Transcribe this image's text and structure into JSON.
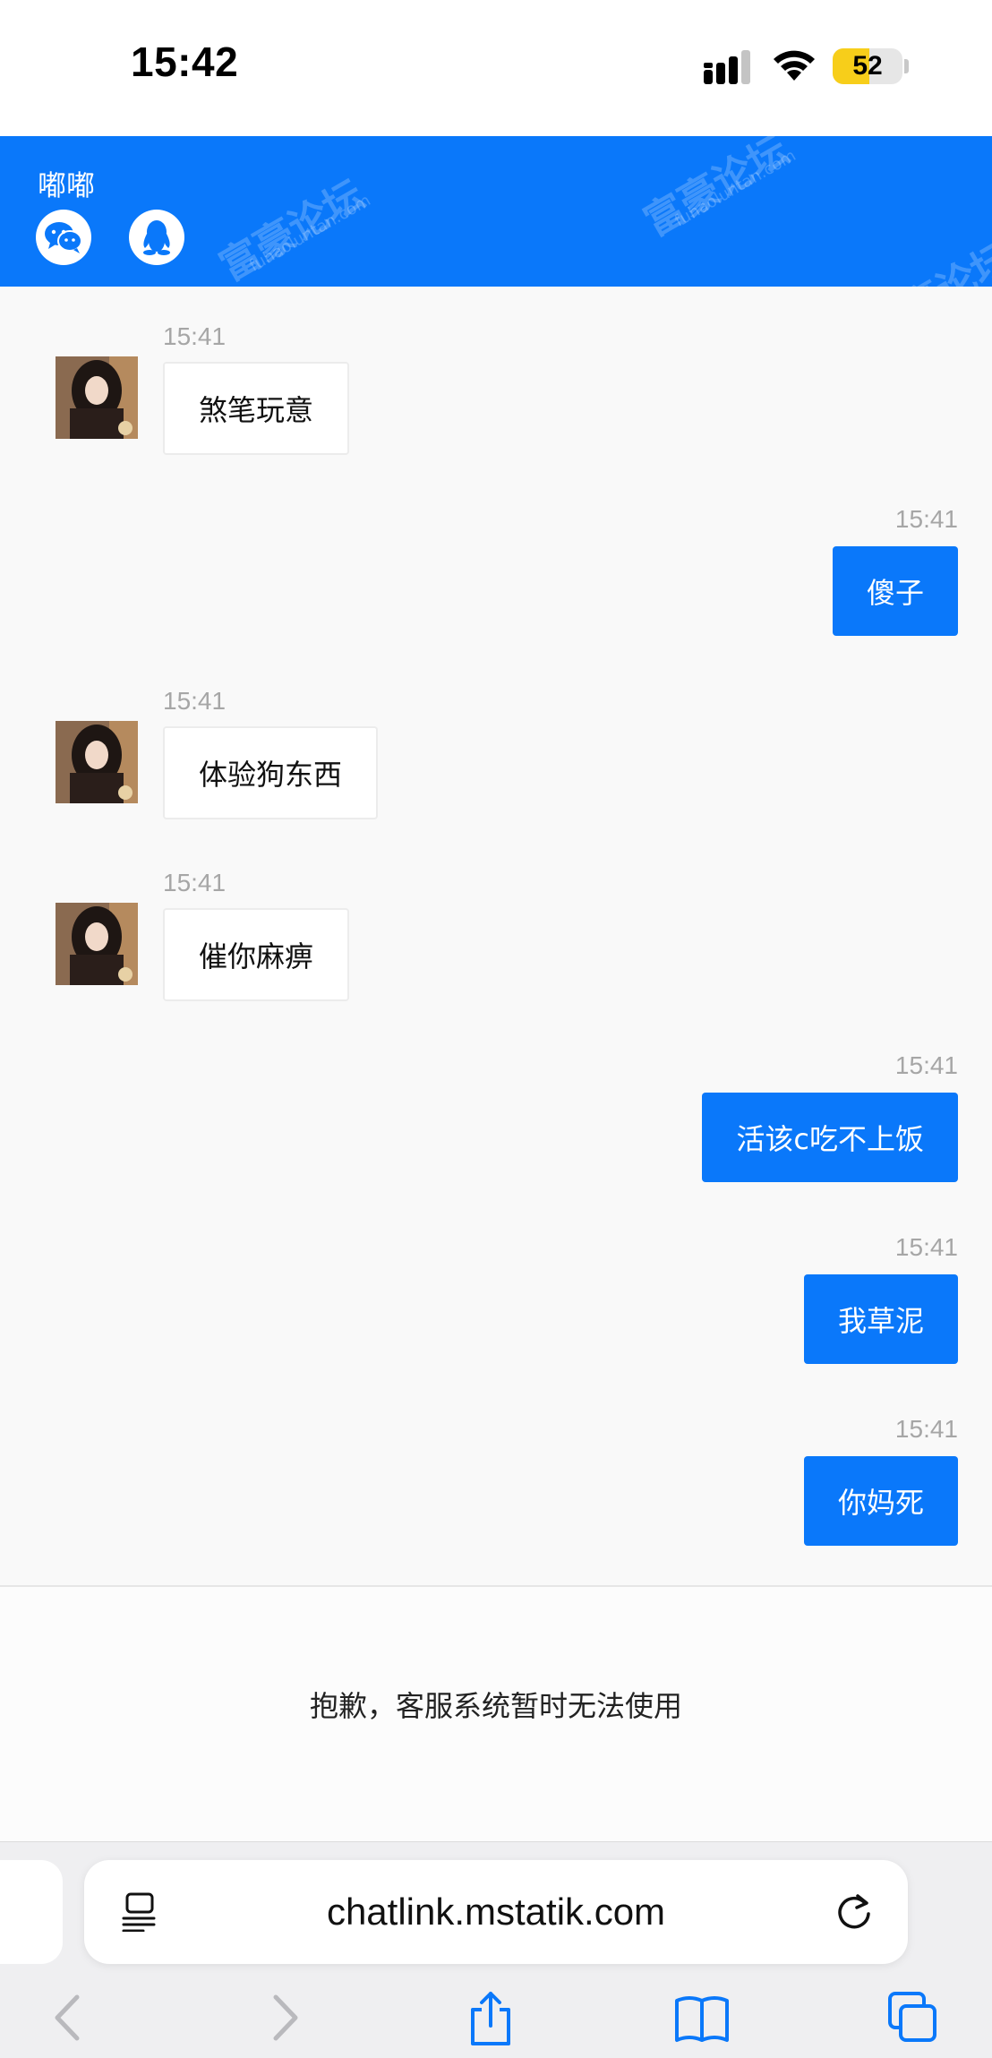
{
  "status_bar": {
    "time": "15:42",
    "battery": "52",
    "battery_level": 0.52
  },
  "header": {
    "title": "嘟嘟",
    "icons": [
      "wechat-icon",
      "qq-icon"
    ],
    "watermark": "富豪论坛",
    "watermark_sub": "fuhaoluntan.com",
    "color": "#0a78fa"
  },
  "messages": [
    {
      "direction": "incoming",
      "time": "15:41",
      "text": "煞笔玩意"
    },
    {
      "direction": "outgoing",
      "time": "15:41",
      "text": "傻子"
    },
    {
      "direction": "incoming",
      "time": "15:41",
      "text": "体验狗东西"
    },
    {
      "direction": "incoming",
      "time": "15:41",
      "text": "催你麻痹"
    },
    {
      "direction": "outgoing",
      "time": "15:41",
      "text": "活该c吃不上饭"
    },
    {
      "direction": "outgoing",
      "time": "15:41",
      "text": "我草泥"
    },
    {
      "direction": "outgoing",
      "time": "15:41",
      "text": "你妈死"
    }
  ],
  "notice": {
    "text": "抱歉，客服系统暂时无法使用"
  },
  "browser": {
    "url": "chatlink.mstatik.com",
    "toolbar_icons": [
      "back-icon",
      "forward-icon",
      "share-icon",
      "bookmarks-icon",
      "tabs-icon"
    ]
  }
}
